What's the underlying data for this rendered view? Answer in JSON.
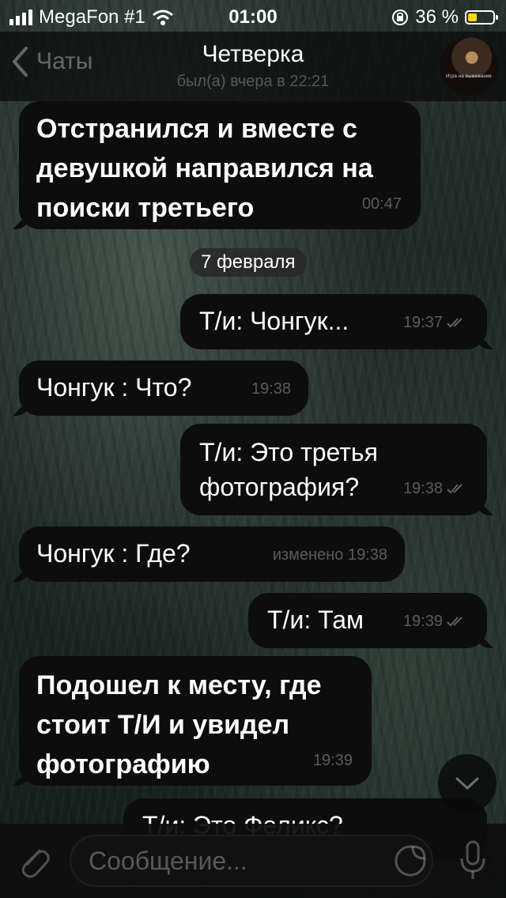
{
  "status_bar": {
    "carrier": "MegaFon #1",
    "time": "01:00",
    "battery_percent": "36 %",
    "battery_level": 0.36,
    "battery_color": "#ffd60a"
  },
  "nav": {
    "back_label": "Чаты",
    "title": "Четверка",
    "status": "был(а) вчера в 22:21",
    "avatar_caption": "Игра на выживание"
  },
  "messages": [
    {
      "side": "in",
      "text": "Отстранился и вместе с\nдевушкой направился на\nпоиски третьего",
      "time": "00:47"
    },
    {
      "side": "out",
      "text": "Т/и: Чонгук...",
      "time": "19:37"
    },
    {
      "side": "in",
      "text": "Чонгук : Что?",
      "time": "19:38"
    },
    {
      "side": "out",
      "text": "Т/и: Это третья\nфотография?",
      "time": "19:38"
    },
    {
      "side": "in",
      "text": "Чонгук : Где?",
      "time": "изменено 19:38"
    },
    {
      "side": "out",
      "text": "Т/и: Там",
      "time": "19:39"
    },
    {
      "side": "in",
      "text": "Подошел к месту, где\nстоит Т/И и увидел\nфотографию",
      "time": "19:39"
    },
    {
      "side": "out",
      "text": "Т/и: Это Феликс?",
      "time": ""
    }
  ],
  "date_separator": "7 февраля",
  "composer": {
    "placeholder": "Сообщение..."
  },
  "icons": [
    "signal-icon",
    "wifi-icon",
    "orientation-lock-icon",
    "battery-icon",
    "back-chevron-icon",
    "read-check-icon",
    "scroll-down-icon",
    "attach-icon",
    "sticker-icon",
    "mic-icon"
  ]
}
